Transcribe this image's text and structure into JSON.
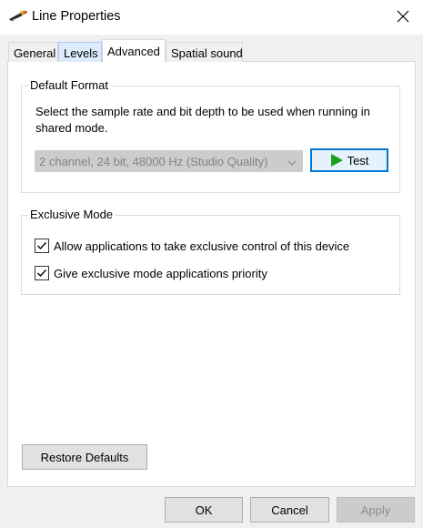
{
  "window": {
    "title": "Line Properties",
    "icon": "audio-line-icon",
    "close_icon": "close-icon"
  },
  "tabs": [
    {
      "label": "General",
      "state": "normal"
    },
    {
      "label": "Levels",
      "state": "hover"
    },
    {
      "label": "Advanced",
      "state": "active"
    },
    {
      "label": "Spatial sound",
      "state": "normal"
    }
  ],
  "default_format": {
    "title": "Default Format",
    "description": "Select the sample rate and bit depth to be used when running in shared mode.",
    "format_select": {
      "selected": "2 channel, 24 bit, 48000 Hz (Studio Quality)",
      "disabled": true
    },
    "test_button": {
      "label": "Test",
      "icon": "play-icon",
      "icon_color": "#1aa01a"
    }
  },
  "exclusive_mode": {
    "title": "Exclusive Mode",
    "options": [
      {
        "label": "Allow applications to take exclusive control of this device",
        "checked": true
      },
      {
        "label": "Give exclusive mode applications priority",
        "checked": true
      }
    ]
  },
  "restore_button": {
    "label": "Restore Defaults"
  },
  "footer": {
    "ok_label": "OK",
    "cancel_label": "Cancel",
    "apply_label": "Apply",
    "apply_disabled": true
  },
  "colors": {
    "accent": "#0078d7",
    "tab_hover": "#dcecfc"
  }
}
